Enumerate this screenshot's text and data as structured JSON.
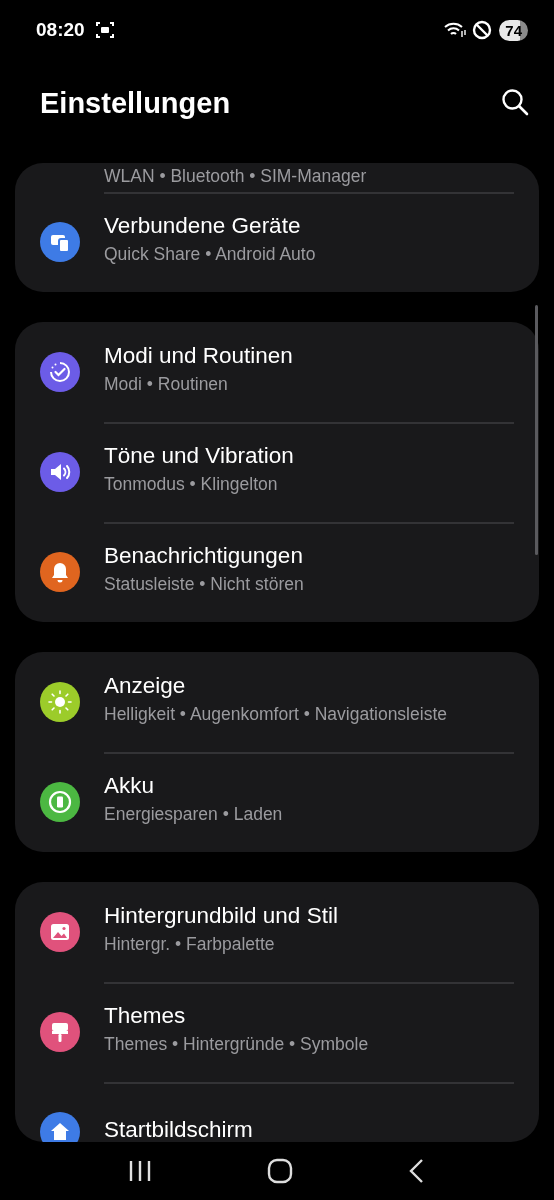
{
  "status_bar": {
    "time": "08:20",
    "battery": "74"
  },
  "header": {
    "title": "Einstellungen"
  },
  "groups": [
    {
      "items": [
        {
          "subtitle": "WLAN • Bluetooth • SIM-Manager"
        },
        {
          "kind": "devices",
          "color": "#3e7be6",
          "title": "Verbundene Geräte",
          "subtitle": "Quick Share • Android Auto"
        }
      ]
    },
    {
      "items": [
        {
          "kind": "modes",
          "color": "#6c5ce7",
          "title": "Modi und Routinen",
          "subtitle": "Modi • Routinen"
        },
        {
          "kind": "sound",
          "color": "#6c5ce7",
          "title": "Töne und Vibration",
          "subtitle": "Tonmodus • Klingelton"
        },
        {
          "kind": "bell",
          "color": "#e0651f",
          "title": "Benachrichtigungen",
          "subtitle": "Statusleiste • Nicht stören"
        }
      ]
    },
    {
      "items": [
        {
          "kind": "sun",
          "color": "#9ccc2a",
          "title": "Anzeige",
          "subtitle": "Helligkeit • Augenkomfort • Navigationsleiste"
        },
        {
          "kind": "battery",
          "color": "#4cb842",
          "title": "Akku",
          "subtitle": "Energiesparen • Laden"
        }
      ]
    },
    {
      "items": [
        {
          "kind": "image",
          "color": "#e0527c",
          "title": "Hintergrundbild und Stil",
          "subtitle": "Hintergr. • Farbpalette"
        },
        {
          "kind": "brush",
          "color": "#e0527c",
          "title": "Themes",
          "subtitle": "Themes • Hintergründe • Symbole"
        },
        {
          "kind": "home",
          "color": "#3e7be6",
          "title": "Startbildschirm"
        }
      ]
    }
  ]
}
